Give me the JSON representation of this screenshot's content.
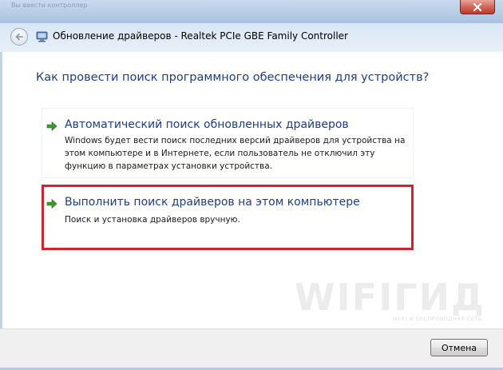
{
  "window": {
    "ghost_caption": "Вы ввести контроллер",
    "close_icon": "close-icon"
  },
  "header": {
    "title": "Обновление драйверов - Realtek PCIe GBE Family Controller",
    "back_icon": "back-arrow-icon",
    "app_icon": "device-manager-icon"
  },
  "content": {
    "question": "Как провести поиск программного обеспечения для устройств?",
    "options": [
      {
        "title": "Автоматический поиск обновленных драйверов",
        "description": "Windows будет вести поиск последних версий драйверов для устройства на этом компьютере и в Интернете, если пользователь не отключил эту функцию в параметрах установки устройства.",
        "icon": "green-arrow-icon"
      },
      {
        "title": "Выполнить поиск драйверов на этом компьютере",
        "description": "Поиск и установка драйверов вручную.",
        "icon": "green-arrow-icon",
        "highlight_color": "#d6202c"
      }
    ]
  },
  "watermark": {
    "brand": "WIFIГИД",
    "tagline": "WI-FI И БЕСПРОВОДНАЯ СЕТЬ"
  },
  "footer": {
    "cancel_label": "Отмена"
  },
  "colors": {
    "link_blue": "#1e3c8c",
    "arrow_green": "#3a9a2a",
    "highlight_red": "#d6202c"
  }
}
